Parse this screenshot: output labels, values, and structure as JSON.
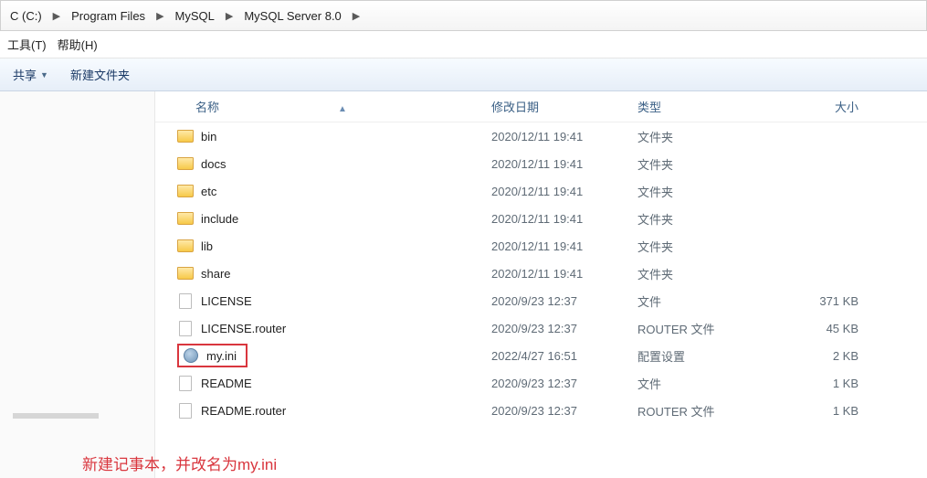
{
  "breadcrumb": {
    "drive": "C (C:)",
    "p1": "Program Files",
    "p2": "MySQL",
    "p3": "MySQL Server 8.0"
  },
  "menu": {
    "tools": "工具(T)",
    "help": "帮助(H)"
  },
  "toolbar": {
    "share": "共享",
    "newfolder": "新建文件夹"
  },
  "columns": {
    "name": "名称",
    "date": "修改日期",
    "type": "类型",
    "size": "大小"
  },
  "rows": [
    {
      "icon": "folder",
      "name": "bin",
      "date": "2020/12/11 19:41",
      "type": "文件夹",
      "size": ""
    },
    {
      "icon": "folder",
      "name": "docs",
      "date": "2020/12/11 19:41",
      "type": "文件夹",
      "size": ""
    },
    {
      "icon": "folder",
      "name": "etc",
      "date": "2020/12/11 19:41",
      "type": "文件夹",
      "size": ""
    },
    {
      "icon": "folder",
      "name": "include",
      "date": "2020/12/11 19:41",
      "type": "文件夹",
      "size": ""
    },
    {
      "icon": "folder",
      "name": "lib",
      "date": "2020/12/11 19:41",
      "type": "文件夹",
      "size": ""
    },
    {
      "icon": "folder",
      "name": "share",
      "date": "2020/12/11 19:41",
      "type": "文件夹",
      "size": ""
    },
    {
      "icon": "file",
      "name": "LICENSE",
      "date": "2020/9/23 12:37",
      "type": "文件",
      "size": "371 KB"
    },
    {
      "icon": "file",
      "name": "LICENSE.router",
      "date": "2020/9/23 12:37",
      "type": "ROUTER 文件",
      "size": "45 KB"
    },
    {
      "icon": "ini",
      "name": "my.ini",
      "date": "2022/4/27 16:51",
      "type": "配置设置",
      "size": "2 KB",
      "hl": true
    },
    {
      "icon": "file",
      "name": "README",
      "date": "2020/9/23 12:37",
      "type": "文件",
      "size": "1 KB"
    },
    {
      "icon": "file",
      "name": "README.router",
      "date": "2020/9/23 12:37",
      "type": "ROUTER 文件",
      "size": "1 KB"
    }
  ],
  "annotation": "新建记事本，并改名为my.ini"
}
